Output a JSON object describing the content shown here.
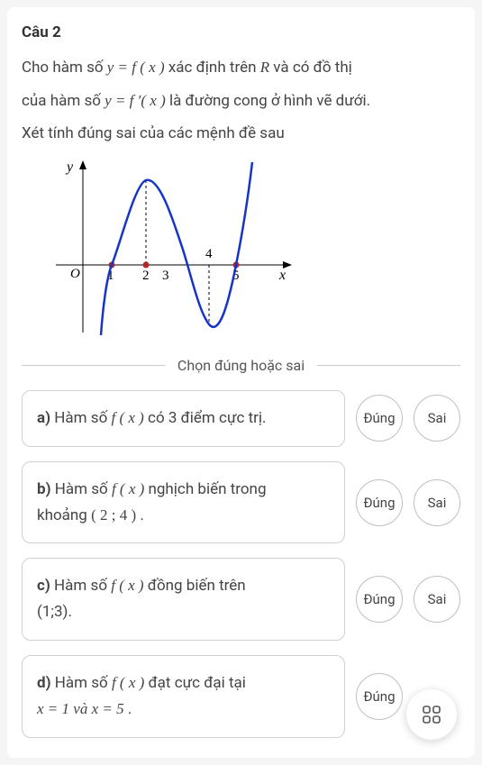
{
  "question": {
    "title": "Câu 2",
    "line1_pre": "Cho hàm số ",
    "line1_math": "y = f ( x )",
    "line1_mid": " xác định trên ",
    "line1_R": "R",
    "line1_post": " và có đồ thị",
    "line2_pre": "của hàm số ",
    "line2_math": "y = f ′( x )",
    "line2_post": " là đường cong ở hình vẽ dưới.",
    "line3": "Xét tính đúng sai của các mệnh đề sau"
  },
  "instruction": "Chọn đúng hoặc sai",
  "options": [
    {
      "key": "a)",
      "text_pre": " Hàm số ",
      "math": "f ( x )",
      "text_post": " có 3 điểm cực trị."
    },
    {
      "key": "b)",
      "text_pre": " Hàm số ",
      "math": "f ( x )",
      "text_post_a": " nghịch biến trong",
      "line2_pre": "khoảng ",
      "line2_math": "( 2 ; 4 )",
      "line2_post": "."
    },
    {
      "key": "c)",
      "text_pre": " Hàm số ",
      "math": "f ( x )",
      "text_post_a": " đồng biến trên",
      "line2": "(1;3)."
    },
    {
      "key": "d)",
      "text_pre": " Hàm số ",
      "math": "f ( x )",
      "text_post_a": " đạt cực đại tại",
      "line2_math": "x = 1 và x = 5",
      "line2_post": "."
    }
  ],
  "buttons": {
    "true": "Đúng",
    "false": "Sai",
    "true_cut": "Đúng"
  },
  "chart_data": {
    "type": "line",
    "title": "",
    "xlabel": "x",
    "ylabel": "y",
    "x_ticks": [
      1,
      2,
      3,
      4,
      5
    ],
    "x_zeros": [
      1,
      2,
      5
    ],
    "local_max_x": 2,
    "local_min_x": 4,
    "series": [
      {
        "name": "f'(x)",
        "values_note": "cubic-like curve crossing x at 1,2,5; local max near x≈ (between 1 and 2), local min at x=4 below axis"
      }
    ],
    "annotations": [
      "O",
      "1",
      "2",
      "3",
      "4",
      "5",
      "x",
      "y"
    ]
  }
}
